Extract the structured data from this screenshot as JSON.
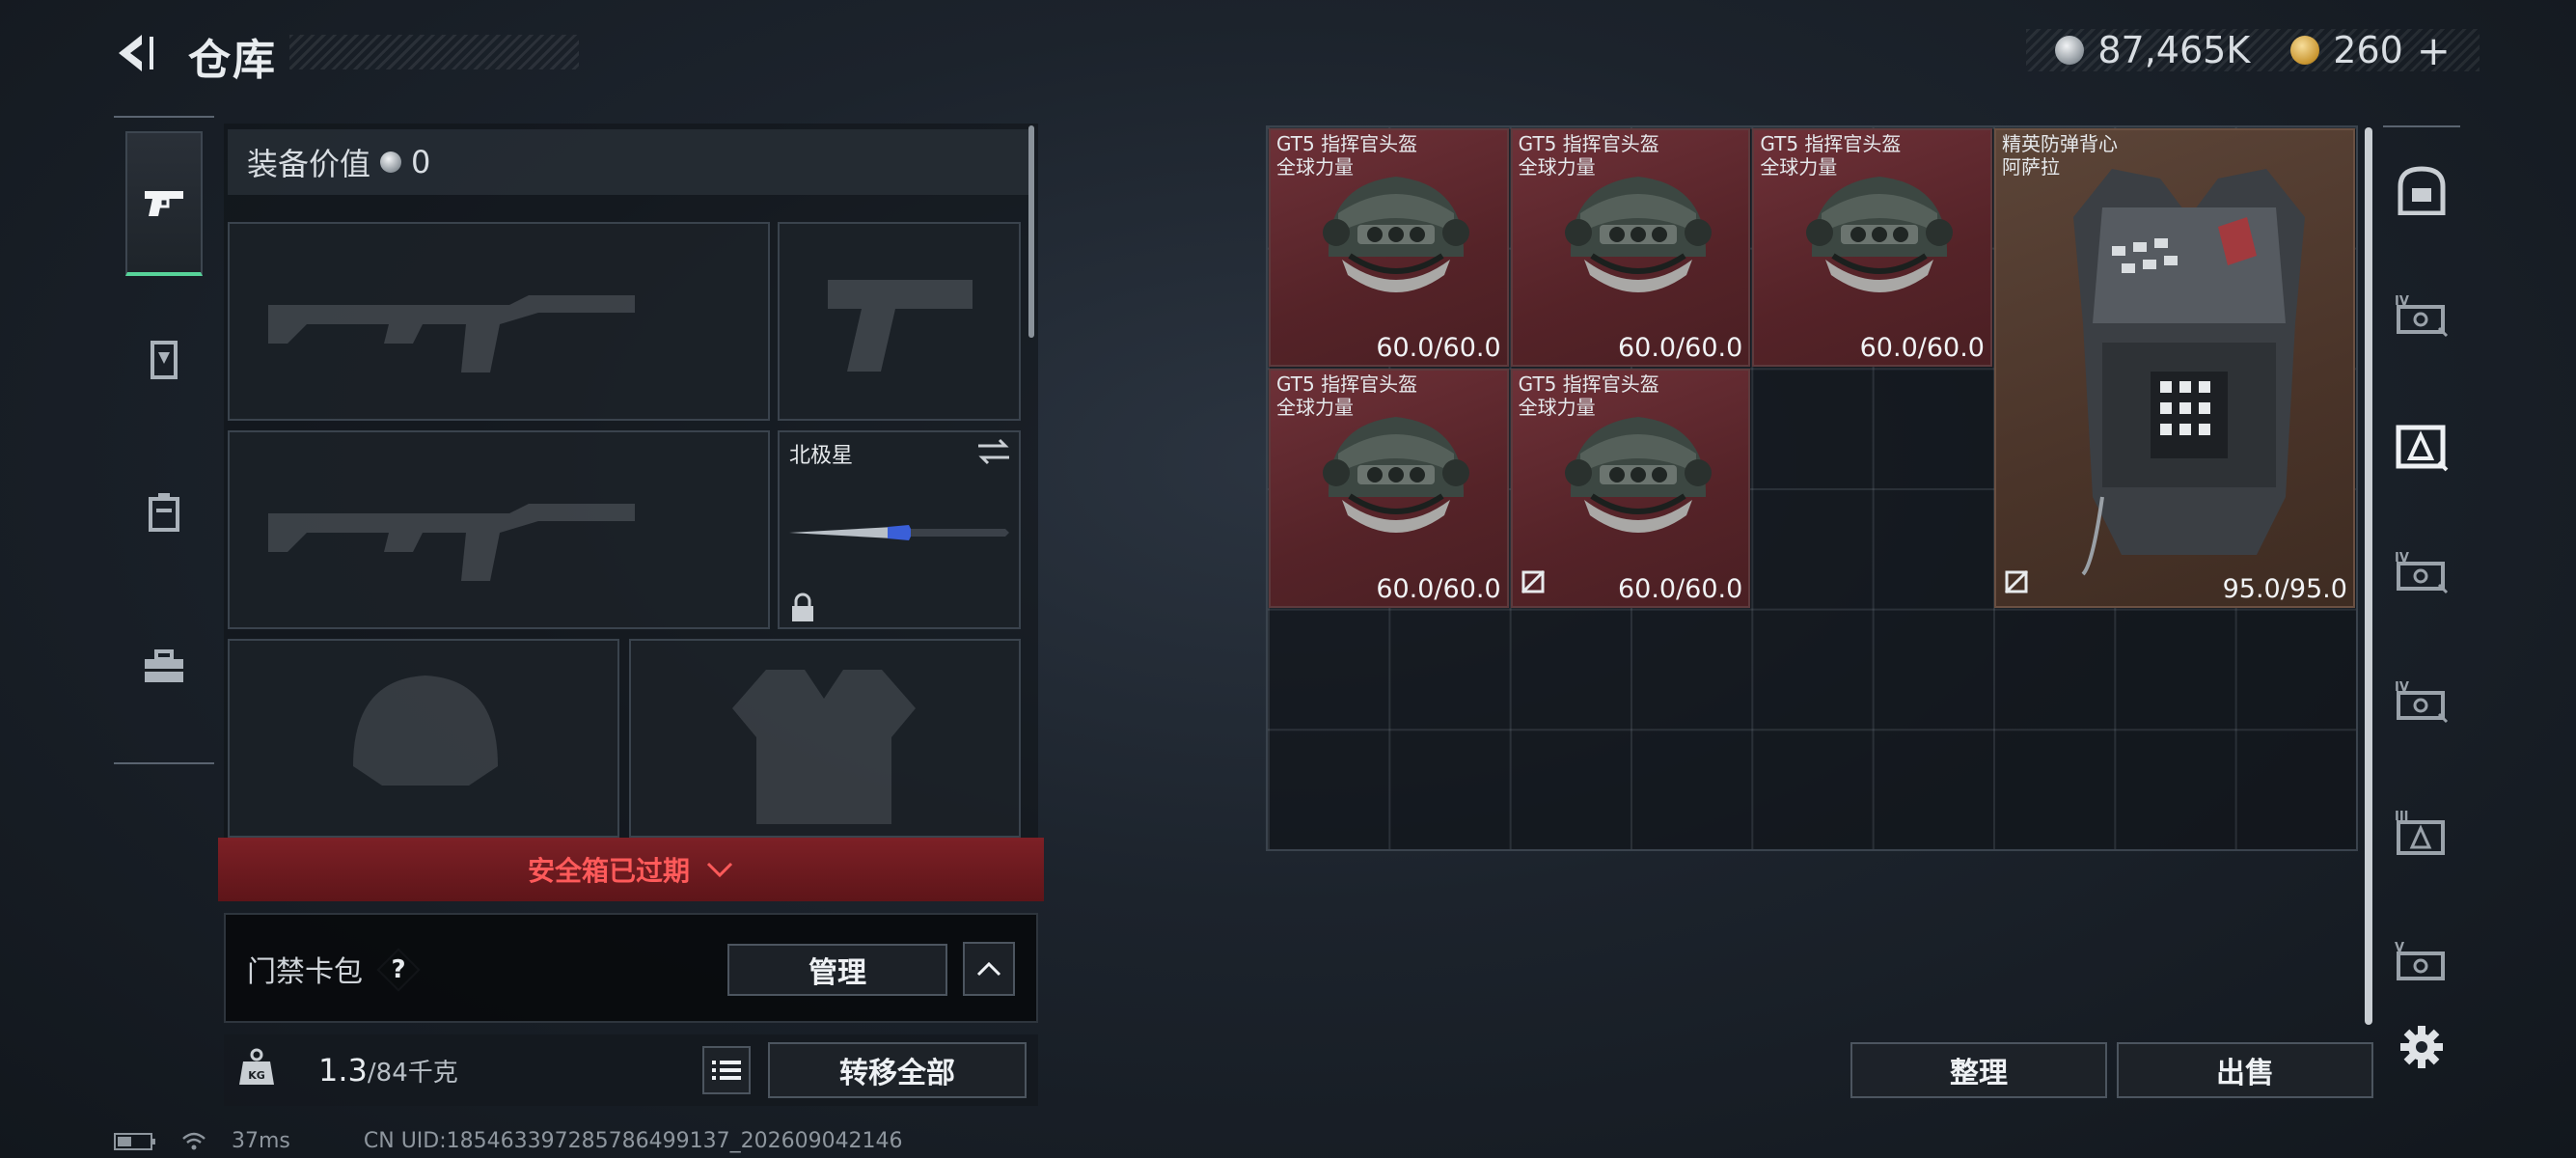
{
  "header": {
    "title": "仓库"
  },
  "currency": {
    "silver": "87,465K",
    "gold": "260",
    "gold_add": "+"
  },
  "loadout": {
    "equip_value_label": "装备价值",
    "equip_value": "0",
    "knife_label": "北极星",
    "safebox_status": "安全箱已过期",
    "keycard_label": "门禁卡包",
    "keycard_help": "?",
    "manage_button": "管理",
    "weight_current": "1.3",
    "weight_max": "/84千克",
    "transfer_all_button": "转移全部"
  },
  "storage": {
    "items": [
      {
        "name": "GT5 指挥官头盔\n全球力量",
        "durability": "60.0/60.0",
        "type": "helmet",
        "rarity": "red",
        "no_discard": false
      },
      {
        "name": "GT5 指挥官头盔\n全球力量",
        "durability": "60.0/60.0",
        "type": "helmet",
        "rarity": "red",
        "no_discard": false
      },
      {
        "name": "GT5 指挥官头盔\n全球力量",
        "durability": "60.0/60.0",
        "type": "helmet",
        "rarity": "red",
        "no_discard": false
      },
      {
        "name": "精英防弹背心\n阿萨拉",
        "durability": "95.0/95.0",
        "type": "vest",
        "rarity": "brown",
        "no_discard": true
      },
      {
        "name": "GT5 指挥官头盔\n全球力量",
        "durability": "60.0/60.0",
        "type": "helmet",
        "rarity": "red",
        "no_discard": false
      },
      {
        "name": "GT5 指挥官头盔\n全球力量",
        "durability": "60.0/60.0",
        "type": "helmet",
        "rarity": "red",
        "no_discard": true
      }
    ],
    "sort_button": "整理",
    "sell_button": "出售"
  },
  "right_tabs": [
    "backpack-icon",
    "container-IV-icon",
    "container-A-icon",
    "container-IV-icon",
    "container-IV-icon",
    "container-III-icon",
    "container-V-icon",
    "settings-icon"
  ],
  "status_bar": {
    "ping": "37ms",
    "uid": "CN UID:185463397285786499137_202609042146"
  },
  "colors": {
    "accent_green": "#57d39a",
    "expired_red": "#ff5a5a",
    "item_red": "#6e3138",
    "item_brown": "#5c4538"
  }
}
